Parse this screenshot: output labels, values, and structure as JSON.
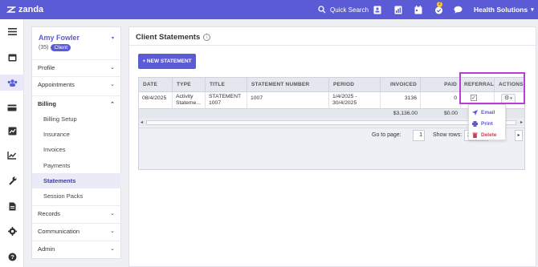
{
  "topbar": {
    "logo_text": "zanda",
    "quick_search": "Quick Search",
    "org_name": "Health Solutions",
    "badge_count": "2",
    "brand_color": "#5b5bd6"
  },
  "client": {
    "name": "Amy Fowler",
    "id": "(35)",
    "tag": "Client"
  },
  "nav": {
    "profile": "Profile",
    "appointments": "Appointments",
    "billing": "Billing",
    "billing_setup": "Billing Setup",
    "insurance": "Insurance",
    "invoices": "Invoices",
    "payments": "Payments",
    "statements": "Statements",
    "session_packs": "Session Packs",
    "records": "Records",
    "communication": "Communication",
    "admin": "Admin"
  },
  "page": {
    "title": "Client Statements",
    "new_button": "+ NEW STATEMENT"
  },
  "table": {
    "headers": {
      "date": "DATE",
      "type": "TYPE",
      "title": "TITLE",
      "number": "STATEMENT NUMBER",
      "period": "PERIOD",
      "invoiced": "INVOICED",
      "paid": "PAID",
      "referral": "REFERRAL",
      "actions": "ACTIONS"
    },
    "row": {
      "date": "08/4/2025",
      "type": "Activity Stateme...",
      "title": "STATEMENT 1007",
      "number": "1007",
      "period": "1/4/2025 - 30/4/2025",
      "invoiced": "3136",
      "paid": "0",
      "referral_checked": "✓"
    },
    "totals": {
      "invoiced": "$3,136.00",
      "paid": "$0.00"
    }
  },
  "pager": {
    "goto_label": "Go to page:",
    "page": "1",
    "show_rows_label": "Show rows:",
    "rows": "20"
  },
  "actions_menu": {
    "email": "Email",
    "print": "Print",
    "delete": "Delete"
  }
}
